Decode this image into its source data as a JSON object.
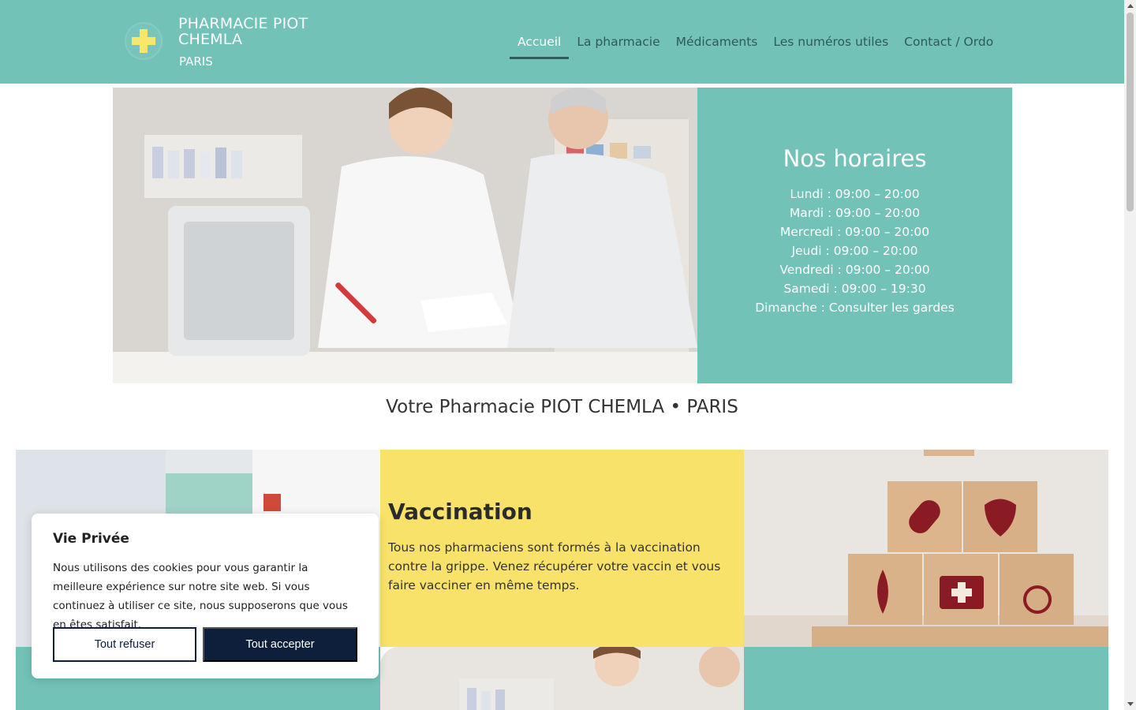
{
  "brand": {
    "title": "PHARMACIE PIOT CHEMLA",
    "city": "PARIS",
    "logo_icon": "pharmacy-cross-icon",
    "colors": {
      "primary": "#72c2b8",
      "accent": "#f8e26a",
      "dark": "#0d1f3a"
    }
  },
  "nav": {
    "items": [
      {
        "label": "Accueil",
        "active": true
      },
      {
        "label": "La pharmacie",
        "active": false
      },
      {
        "label": "Médicaments",
        "active": false
      },
      {
        "label": "Les numéros utiles",
        "active": false
      },
      {
        "label": "Contact / Ordo",
        "active": false
      }
    ]
  },
  "hours": {
    "title": "Nos horaires",
    "lines": [
      "Lundi : 09:00 – 20:00",
      "Mardi : 09:00 – 20:00",
      "Mercredi : 09:00 – 20:00",
      "Jeudi : 09:00 – 20:00",
      "Vendredi : 09:00 – 20:00",
      "Samedi : 09:00 – 19:30",
      "Dimanche : Consulter les gardes"
    ]
  },
  "tagline": "Votre Pharmacie PIOT CHEMLA • PARIS",
  "vaccination": {
    "title": "Vaccination",
    "text": "Tous nos pharmaciens sont formés à la vaccination contre la grippe. Venez récupérer votre vaccin et vous faire vacciner en même temps."
  },
  "cookie": {
    "title": "Vie Privée",
    "text": "Nous utilisons des cookies pour vous garantir la meilleure expérience sur notre site web. Si vous continuez à utiliser ce site, nous supposerons que vous en êtes satisfait.",
    "refuse_label": "Tout refuser",
    "accept_label": "Tout accepter"
  }
}
